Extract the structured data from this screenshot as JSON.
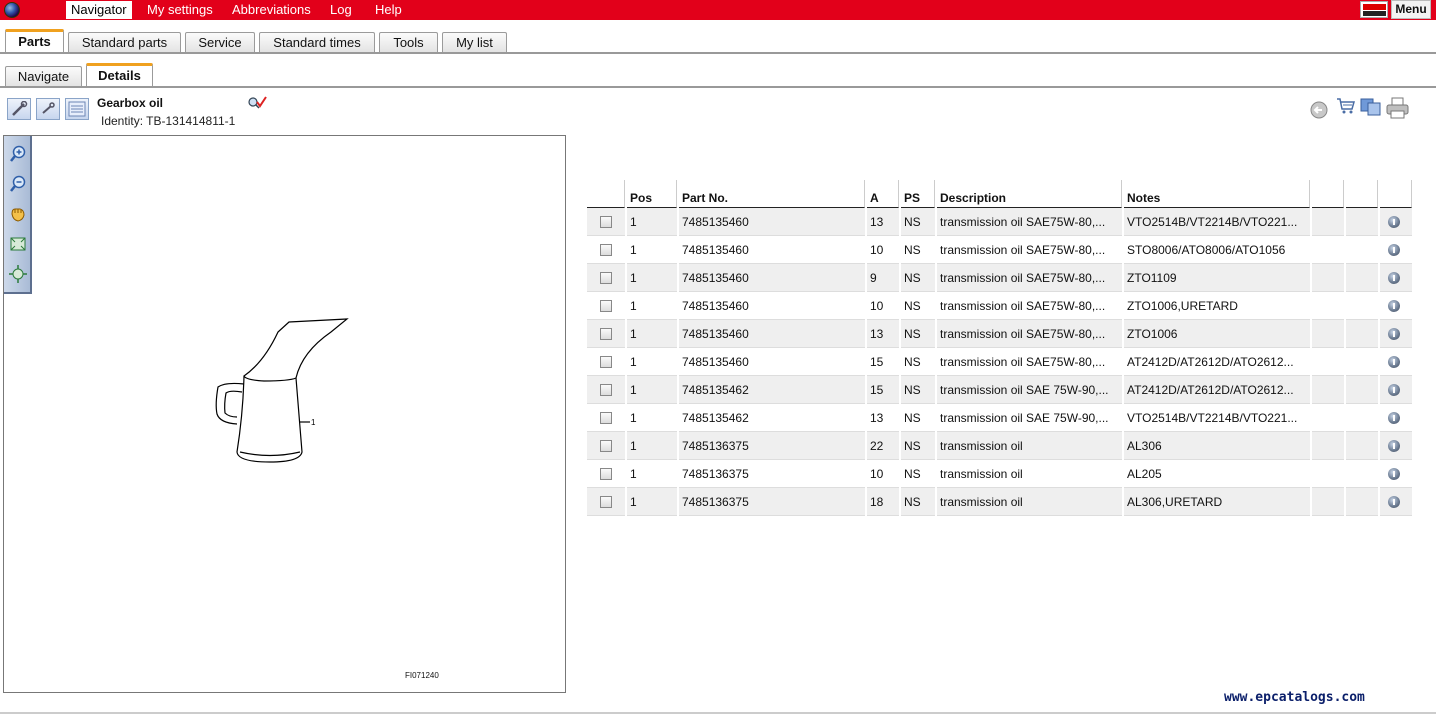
{
  "top_menu": {
    "items": [
      "Navigator",
      "My settings",
      "Abbreviations",
      "Log",
      "Help"
    ],
    "active": "Navigator",
    "menu_label": "Menu",
    "brand_logo": "RENAULT TRUCKS",
    "accent_color": "#e2001a"
  },
  "main_tabs": {
    "items": [
      "Parts",
      "Standard parts",
      "Service",
      "Standard times",
      "Tools",
      "My list"
    ],
    "active": "Parts"
  },
  "sub_tabs": {
    "items": [
      "Navigate",
      "Details"
    ],
    "active": "Details"
  },
  "header": {
    "title": "Gearbox oil",
    "identity": "Identity: TB-131414811-1"
  },
  "toolbar_icons": {
    "left": [
      "wrench-tool-icon",
      "wrench-small-icon",
      "document-list-icon"
    ],
    "title_action": "search-check-icon",
    "right": [
      "back-arrow-icon",
      "shopping-cart-icon",
      "copy-pages-icon",
      "printer-icon"
    ]
  },
  "drawing": {
    "zoom_tools": [
      "zoom-in-icon",
      "zoom-out-icon",
      "pan-hand-icon",
      "fit-page-icon",
      "fit-selection-icon"
    ],
    "callout": "1",
    "figure_id": "FI071240"
  },
  "table": {
    "headers": [
      "",
      "Pos",
      "Part No.",
      "A",
      "PS",
      "Description",
      "Notes",
      "",
      "",
      ""
    ],
    "rows": [
      {
        "pos": "1",
        "part_no": "7485135460",
        "a": "13",
        "ps": "NS",
        "description": "transmission oil SAE75W-80,...",
        "notes": "VTO2514B/VT2214B/VTO221..."
      },
      {
        "pos": "1",
        "part_no": "7485135460",
        "a": "10",
        "ps": "NS",
        "description": "transmission oil SAE75W-80,...",
        "notes": "STO8006/ATO8006/ATO1056"
      },
      {
        "pos": "1",
        "part_no": "7485135460",
        "a": "9",
        "ps": "NS",
        "description": "transmission oil SAE75W-80,...",
        "notes": "ZTO1109"
      },
      {
        "pos": "1",
        "part_no": "7485135460",
        "a": "10",
        "ps": "NS",
        "description": "transmission oil SAE75W-80,...",
        "notes": "ZTO1006,URETARD"
      },
      {
        "pos": "1",
        "part_no": "7485135460",
        "a": "13",
        "ps": "NS",
        "description": "transmission oil SAE75W-80,...",
        "notes": "ZTO1006"
      },
      {
        "pos": "1",
        "part_no": "7485135460",
        "a": "15",
        "ps": "NS",
        "description": "transmission oil SAE75W-80,...",
        "notes": "AT2412D/AT2612D/ATO2612..."
      },
      {
        "pos": "1",
        "part_no": "7485135462",
        "a": "15",
        "ps": "NS",
        "description": "transmission oil SAE 75W-90,...",
        "notes": "AT2412D/AT2612D/ATO2612..."
      },
      {
        "pos": "1",
        "part_no": "7485135462",
        "a": "13",
        "ps": "NS",
        "description": "transmission oil SAE 75W-90,...",
        "notes": "VTO2514B/VT2214B/VTO221..."
      },
      {
        "pos": "1",
        "part_no": "7485136375",
        "a": "22",
        "ps": "NS",
        "description": "transmission oil",
        "notes": "AL306"
      },
      {
        "pos": "1",
        "part_no": "7485136375",
        "a": "10",
        "ps": "NS",
        "description": "transmission oil",
        "notes": "AL205"
      },
      {
        "pos": "1",
        "part_no": "7485136375",
        "a": "18",
        "ps": "NS",
        "description": "transmission oil",
        "notes": "AL306,URETARD"
      }
    ]
  },
  "watermark": "www.epcatalogs.com"
}
